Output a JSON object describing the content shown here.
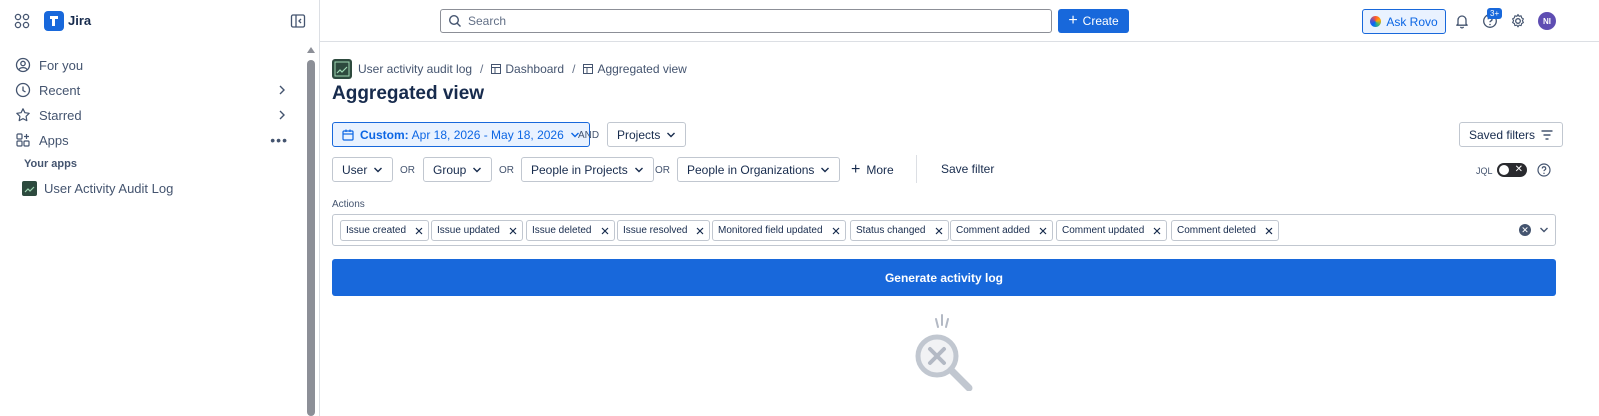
{
  "app": {
    "name": "Jira"
  },
  "sidebar": {
    "items": [
      {
        "label": "For you",
        "icon": "person-circle-icon"
      },
      {
        "label": "Recent",
        "icon": "clock-icon"
      },
      {
        "label": "Starred",
        "icon": "star-icon"
      },
      {
        "label": "Apps",
        "icon": "apps-icon"
      }
    ],
    "section_label": "Your apps",
    "apps": [
      {
        "label": "User Activity Audit Log"
      }
    ]
  },
  "topbar": {
    "search_placeholder": "Search",
    "create_label": "Create",
    "ask_rovo_label": "Ask Rovo",
    "notification_badge": "3+",
    "avatar_initials": "NI"
  },
  "breadcrumb": {
    "items": [
      "User activity audit log",
      "Dashboard",
      "Aggregated view"
    ]
  },
  "page": {
    "title": "Aggregated view"
  },
  "filters": {
    "date_prefix": "Custom:",
    "date_range": "Apr 18, 2026 - May 18, 2026",
    "and_label": "AND",
    "projects_label": "Projects",
    "saved_filters_label": "Saved filters",
    "user_label": "User",
    "or_label": "OR",
    "group_label": "Group",
    "people_in_projects_label": "People in Projects",
    "people_in_orgs_label": "People in Organizations",
    "more_label": "More",
    "save_filter_label": "Save filter",
    "jql_label": "JQL"
  },
  "actions": {
    "label": "Actions",
    "chips": [
      "Issue created",
      "Issue updated",
      "Issue deleted",
      "Issue resolved",
      "Monitored field updated",
      "Status changed",
      "Comment added",
      "Comment updated",
      "Comment deleted"
    ]
  },
  "generate_button_label": "Generate activity log",
  "colors": {
    "primary": "#1868db",
    "text": "#172b4d",
    "muted": "#44546f"
  }
}
